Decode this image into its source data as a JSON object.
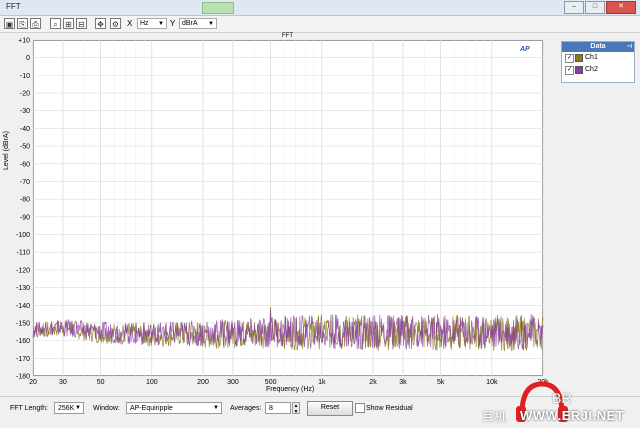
{
  "window": {
    "title": "FFT",
    "ghost_tab": ""
  },
  "toolbar": {
    "x_label": "X",
    "x_unit": "Hz",
    "y_label": "Y",
    "y_unit": "dBrA"
  },
  "chart_data": {
    "type": "line",
    "title": "FFT",
    "xlabel": "Frequency (Hz)",
    "ylabel": "Level (dBrA)",
    "xscale": "log",
    "xlim": [
      20,
      20000
    ],
    "ylim": [
      -180,
      10
    ],
    "x_ticks": [
      {
        "value": 20,
        "label": "20"
      },
      {
        "value": 30,
        "label": "30"
      },
      {
        "value": 50,
        "label": "50"
      },
      {
        "value": 100,
        "label": "100"
      },
      {
        "value": 200,
        "label": "200"
      },
      {
        "value": 300,
        "label": "300"
      },
      {
        "value": 500,
        "label": "500"
      },
      {
        "value": 1000,
        "label": "1k"
      },
      {
        "value": 2000,
        "label": "2k"
      },
      {
        "value": 3000,
        "label": "3k"
      },
      {
        "value": 5000,
        "label": "5k"
      },
      {
        "value": 10000,
        "label": "10k"
      },
      {
        "value": 20000,
        "label": "20k"
      }
    ],
    "y_ticks": [
      {
        "value": 10,
        "label": "+10"
      },
      {
        "value": 0,
        "label": "0"
      },
      {
        "value": -10,
        "label": "-10"
      },
      {
        "value": -20,
        "label": "-20"
      },
      {
        "value": -30,
        "label": "-30"
      },
      {
        "value": -40,
        "label": "-40"
      },
      {
        "value": -50,
        "label": "-50"
      },
      {
        "value": -60,
        "label": "-60"
      },
      {
        "value": -70,
        "label": "-70"
      },
      {
        "value": -80,
        "label": "-80"
      },
      {
        "value": -90,
        "label": "-90"
      },
      {
        "value": -100,
        "label": "-100"
      },
      {
        "value": -110,
        "label": "-110"
      },
      {
        "value": -120,
        "label": "-120"
      },
      {
        "value": -130,
        "label": "-130"
      },
      {
        "value": -140,
        "label": "-140"
      },
      {
        "value": -150,
        "label": "-150"
      },
      {
        "value": -160,
        "label": "-160"
      },
      {
        "value": -170,
        "label": "-170"
      },
      {
        "value": -180,
        "label": "-180"
      }
    ],
    "grid": true,
    "legend": "right, outside plot",
    "series": [
      {
        "name": "Ch1",
        "color": "#8a7a1e",
        "x": [
          20,
          25,
          30,
          40,
          50,
          70,
          100,
          150,
          200,
          300,
          400,
          500,
          700,
          1000,
          1500,
          2000,
          3000,
          5000,
          7000,
          10000,
          15000,
          20000
        ],
        "y": [
          -153,
          -154,
          -152,
          -155,
          -156,
          -156,
          -157,
          -156,
          -157,
          -156,
          -156,
          -155,
          -156,
          -155,
          -155,
          -156,
          -155,
          -156,
          -155,
          -156,
          -156,
          -155
        ],
        "spikes": [
          {
            "x": 500,
            "y": -141
          }
        ]
      },
      {
        "name": "Ch2",
        "color": "#8a3fa0",
        "x": [
          20,
          25,
          30,
          40,
          50,
          70,
          100,
          150,
          200,
          300,
          400,
          500,
          700,
          1000,
          1500,
          2000,
          3000,
          5000,
          7000,
          10000,
          15000,
          20000
        ],
        "y": [
          -154,
          -153,
          -153,
          -154,
          -155,
          -156,
          -156,
          -156,
          -156,
          -155,
          -156,
          -155,
          -155,
          -155,
          -155,
          -155,
          -155,
          -155,
          -155,
          -155,
          -155,
          -155
        ],
        "spikes": [
          {
            "x": 500,
            "y": -143
          }
        ]
      }
    ]
  },
  "legend_panel": {
    "header": "Data",
    "items": [
      {
        "label": "Ch1",
        "checked": "✓",
        "color": "#8a7a1e"
      },
      {
        "label": "Ch2",
        "checked": "✓",
        "color": "#8a3fa0"
      }
    ]
  },
  "bottom": {
    "fft_length_label": "FFT Length:",
    "fft_length_value": "256K",
    "window_label": "Window:",
    "window_value": "AP-Equiripple",
    "averages_label": "Averages:",
    "averages_value": "8",
    "reset_label": "Reset",
    "show_residual_label": "Show Residual"
  },
  "watermark": {
    "url": "WWW.ERJI.NET",
    "cn": "耳机",
    "mark": "BR"
  }
}
